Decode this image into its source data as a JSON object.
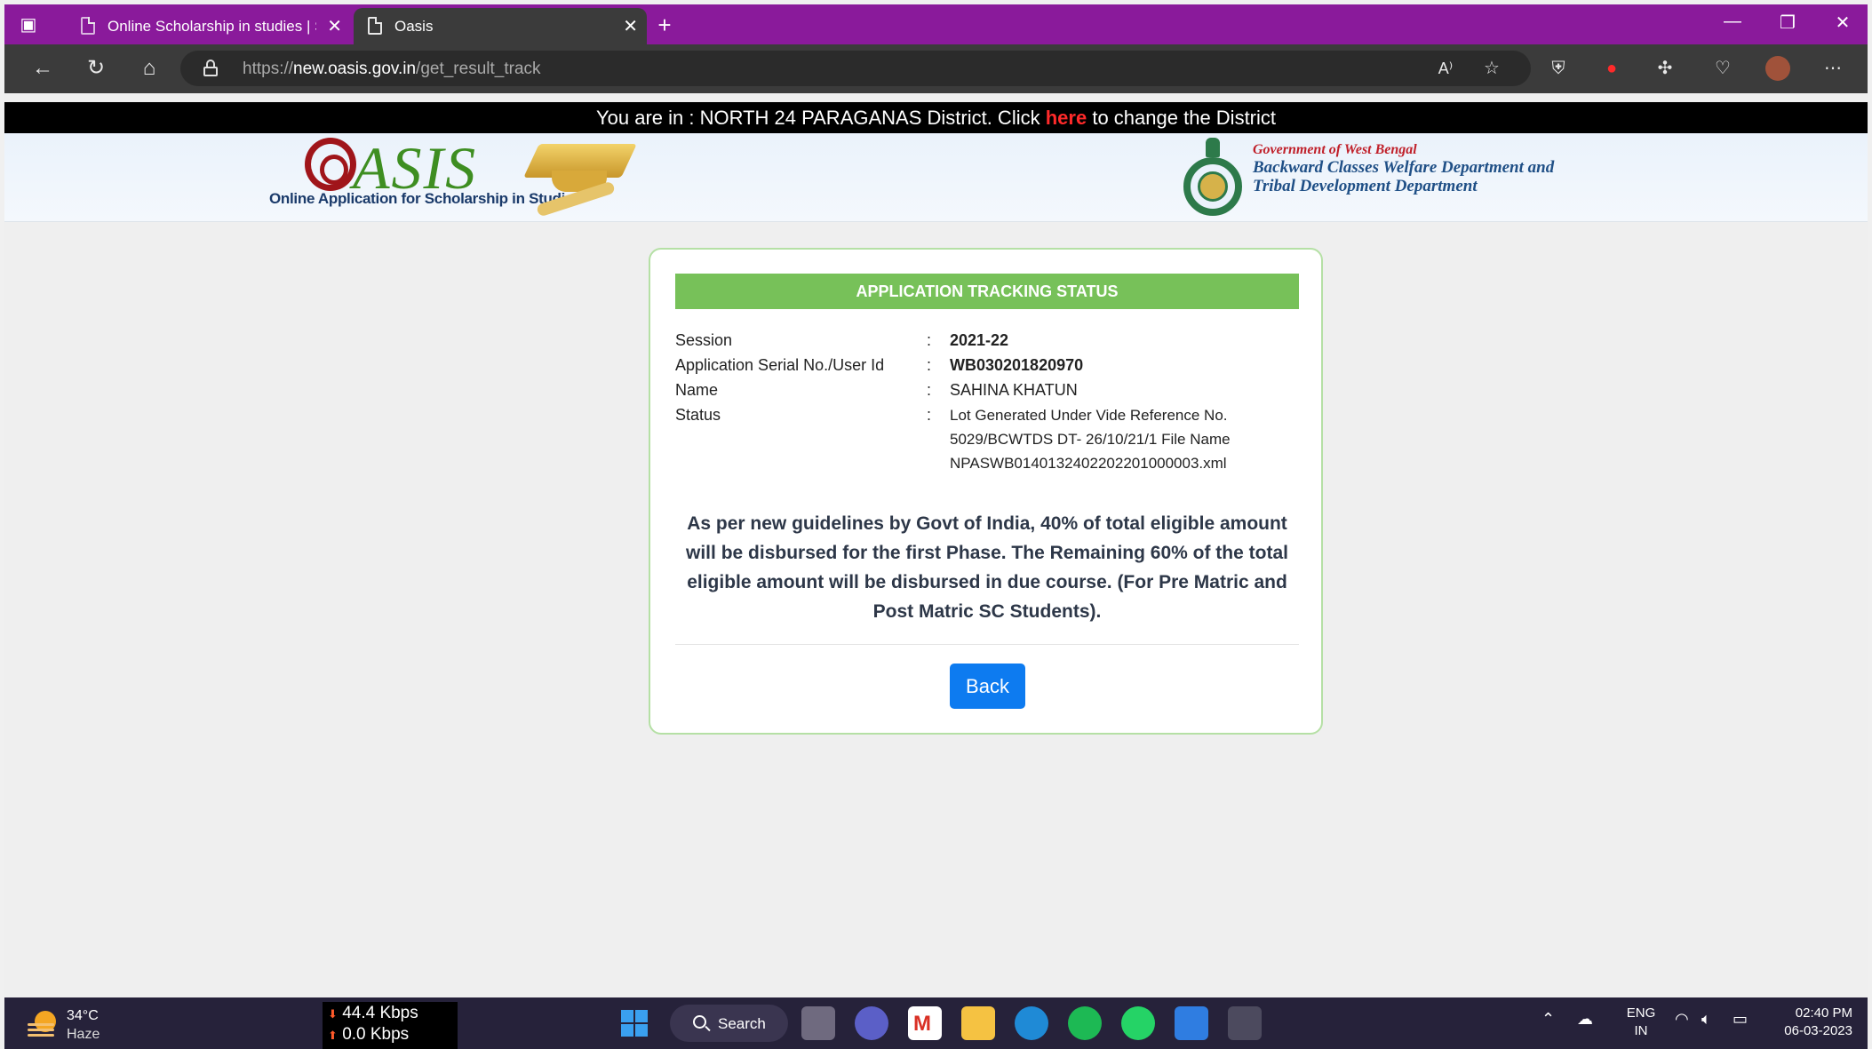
{
  "browser": {
    "tabs": [
      {
        "title": "Online Scholarship in studies | Sc",
        "active": false
      },
      {
        "title": "Oasis",
        "active": true
      }
    ],
    "url_prefix": "https://",
    "url_host": "new.oasis.gov.in",
    "url_path": "/get_result_track",
    "accent": "#8a1a9b"
  },
  "district_banner": {
    "prefix": "You are in : NORTH 24 PARAGANAS District. Click",
    "link": "here",
    "suffix": "to change the District"
  },
  "header": {
    "logo_text": "ASIS",
    "logo_subtitle": "Online Application for Scholarship in Studies",
    "gov_line1": "Government of West Bengal",
    "gov_line2": "Backward Classes Welfare Department and",
    "gov_line3": "Tribal Development Department"
  },
  "card": {
    "title": "APPLICATION TRACKING STATUS",
    "rows": [
      {
        "label": "Session",
        "colon": ":",
        "value": "2021-22"
      },
      {
        "label": "Application Serial No./User Id",
        "colon": ":",
        "value": "WB030201820970"
      },
      {
        "label": "Name",
        "colon": ":",
        "value": "SAHINA KHATUN"
      },
      {
        "label": "Status",
        "colon": ":",
        "value": "Lot Generated Under Vide Reference No. 5029/BCWTDS DT- 26/10/21/1 File Name NPASWB0140132402202201000003.xml"
      }
    ],
    "notice": "As per new guidelines by Govt of India, 40% of total eligible amount will be disbursed for the first Phase. The Remaining 60% of the total eligible amount will be disbursed in due course. (For Pre Matric and Post Matric SC Students).",
    "back_label": "Back",
    "header_color": "#77c159",
    "button_color": "#0d7bf0"
  },
  "taskbar": {
    "temp": "34°C",
    "weather": "Haze",
    "net_down": "44.4 Kbps",
    "net_up": "0.0 Kbps",
    "search_label": "Search",
    "lang_line1": "ENG",
    "lang_line2": "IN",
    "time": "02:40 PM",
    "date": "06-03-2023"
  }
}
